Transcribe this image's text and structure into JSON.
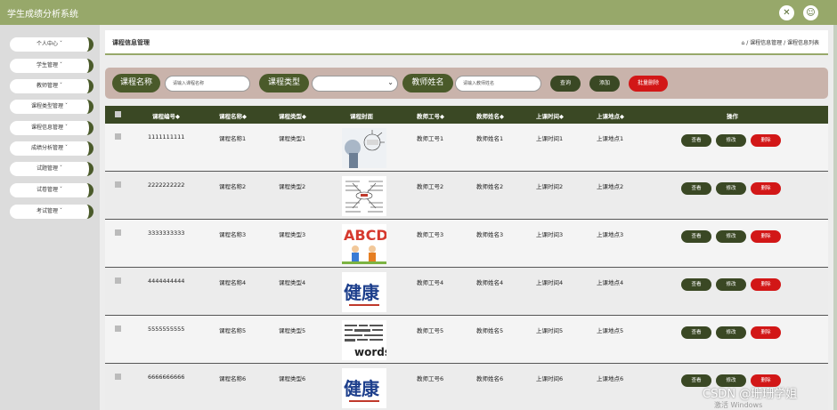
{
  "app": {
    "title": "学生成绩分析系统"
  },
  "header": {
    "icons": [
      "expand-icon",
      "user-icon"
    ]
  },
  "sidebar": {
    "items": [
      {
        "label": "个人中心 ˇ"
      },
      {
        "label": "学生管理 ˇ"
      },
      {
        "label": "教师管理 ˇ"
      },
      {
        "label": "课程类型管理 ˇ"
      },
      {
        "label": "课程信息管理 ˇ"
      },
      {
        "label": "成绩分析管理 ˇ"
      },
      {
        "label": "试题管理 ˇ"
      },
      {
        "label": "试卷管理 ˇ"
      },
      {
        "label": "考试管理 ˇ"
      }
    ]
  },
  "breadcrumb": {
    "title": "课程信息管理",
    "path": "/ 课程信息管理 / 课程信息列表"
  },
  "filters": {
    "course_name_label": "课程名称",
    "course_name_placeholder": "请输入课程名称",
    "course_type_label": "课程类型",
    "teacher_name_label": "教师姓名",
    "teacher_name_placeholder": "请输入教师姓名",
    "search_label": "查询",
    "add_label": "添加",
    "batch_delete_label": "批量删除"
  },
  "table": {
    "headers": [
      "课程编号◆",
      "课程名称◆",
      "课程类型◆",
      "课程封面",
      "教师工号◆",
      "教师姓名◆",
      "上课时间◆",
      "上课地点◆",
      "操作"
    ],
    "rows": [
      {
        "id": "1111111111",
        "name": "课程名称1",
        "type": "课程类型1",
        "tid": "教师工号1",
        "tname": "教师姓名1",
        "time": "上课时间1",
        "place": "上课地点1",
        "cover": "cover-1"
      },
      {
        "id": "2222222222",
        "name": "课程名称2",
        "type": "课程类型2",
        "tid": "教师工号2",
        "tname": "教师姓名2",
        "time": "上课时间2",
        "place": "上课地点2",
        "cover": "cover-2"
      },
      {
        "id": "3333333333",
        "name": "课程名称3",
        "type": "课程类型3",
        "tid": "教师工号3",
        "tname": "教师姓名3",
        "time": "上课时间3",
        "place": "上课地点3",
        "cover": "cover-3"
      },
      {
        "id": "4444444444",
        "name": "课程名称4",
        "type": "课程类型4",
        "tid": "教师工号4",
        "tname": "教师姓名4",
        "time": "上课时间4",
        "place": "上课地点4",
        "cover": "cover-4"
      },
      {
        "id": "5555555555",
        "name": "课程名称5",
        "type": "课程类型5",
        "tid": "教师工号5",
        "tname": "教师姓名5",
        "time": "上课时间5",
        "place": "上课地点5",
        "cover": "cover-5"
      },
      {
        "id": "6666666666",
        "name": "课程名称6",
        "type": "课程类型6",
        "tid": "教师工号6",
        "tname": "教师姓名6",
        "time": "上课时间6",
        "place": "上课地点6",
        "cover": "cover-6"
      }
    ],
    "actions": {
      "view": "查看",
      "edit": "修改",
      "delete": "删除"
    }
  },
  "cover_text": {
    "abcd": "ABCD",
    "words": "words",
    "jian": "健康"
  },
  "watermark": {
    "line1": "CSDN @珊珊学姐",
    "line2": "激活 Windows"
  },
  "colors": {
    "topbar": "#97a86a",
    "dark_green": "#3a4824",
    "delete_red": "#d21717",
    "filter_bg": "#c9b3ab"
  }
}
